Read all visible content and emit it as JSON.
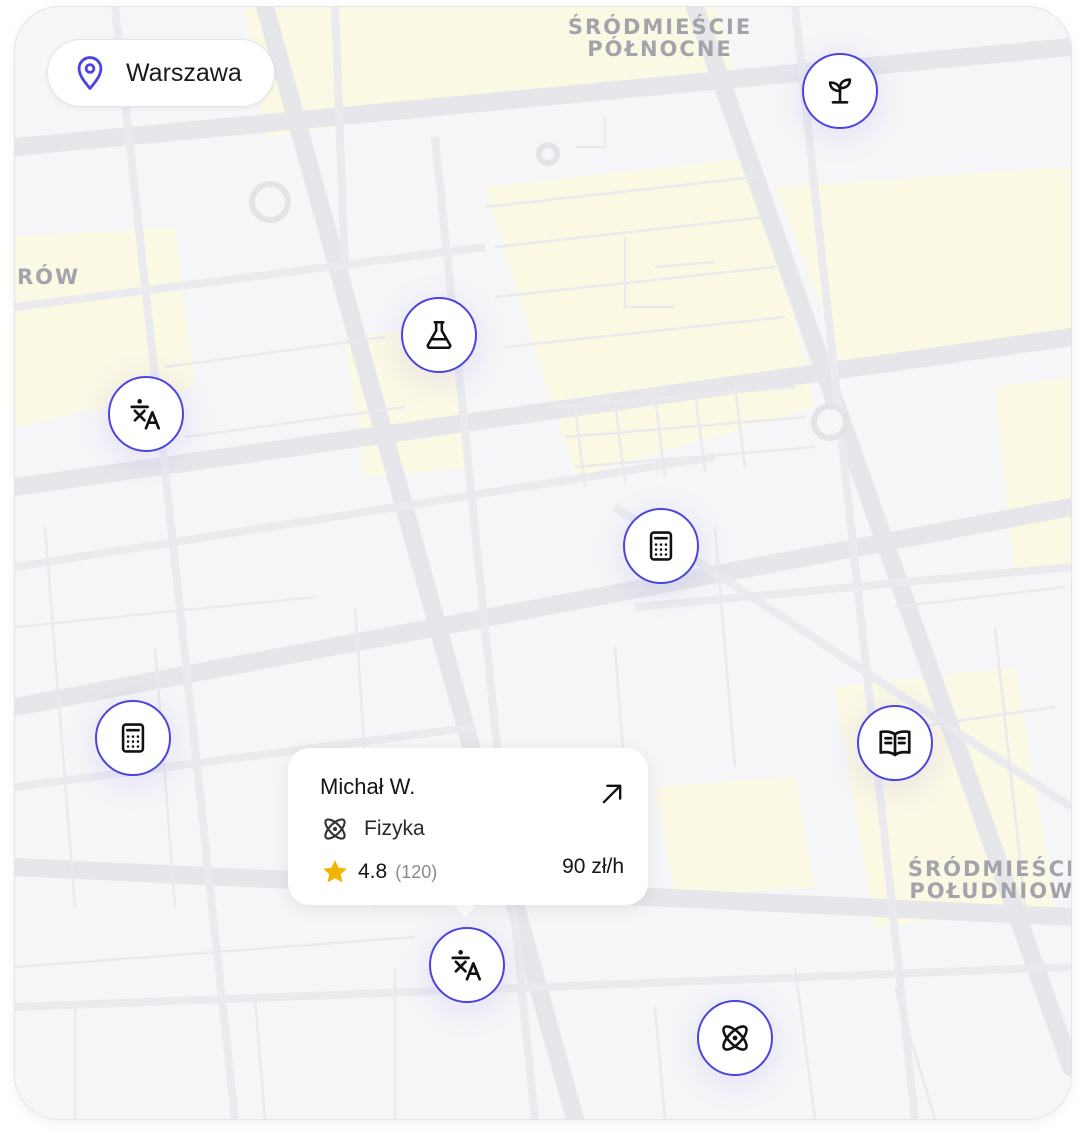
{
  "map": {
    "districts": {
      "north": "ŚRÓDMIEŚCIE\nPÓŁNOCNE",
      "south": "ŚRÓDMIEŚCIE\nPOŁUDNIOWE",
      "west": "RÓW"
    }
  },
  "location": {
    "icon": "location-pin-icon",
    "city": "Warszawa"
  },
  "markers": [
    {
      "subject": "biology",
      "icon": "sprout-icon"
    },
    {
      "subject": "chemistry",
      "icon": "flask-icon"
    },
    {
      "subject": "languages",
      "icon": "translate-icon"
    },
    {
      "subject": "math",
      "icon": "calculator-icon"
    },
    {
      "subject": "math",
      "icon": "calculator-icon"
    },
    {
      "subject": "literature",
      "icon": "open-book-icon"
    },
    {
      "subject": "languages",
      "icon": "translate-icon"
    },
    {
      "subject": "physics",
      "icon": "atom-icon"
    }
  ],
  "tutor_card": {
    "name": "Michał W.",
    "subject": "Fizyka",
    "subject_icon": "atom-icon",
    "rating": "4.8",
    "reviews": "(120)",
    "price": "90 zł/h",
    "link_icon": "arrow-up-right-icon"
  },
  "colors": {
    "accent": "#4b44e0",
    "star": "#f5b301",
    "map_background": "#f6f6f8",
    "road": "#e5e5ea",
    "highlight_area": "#fbf8e6"
  }
}
